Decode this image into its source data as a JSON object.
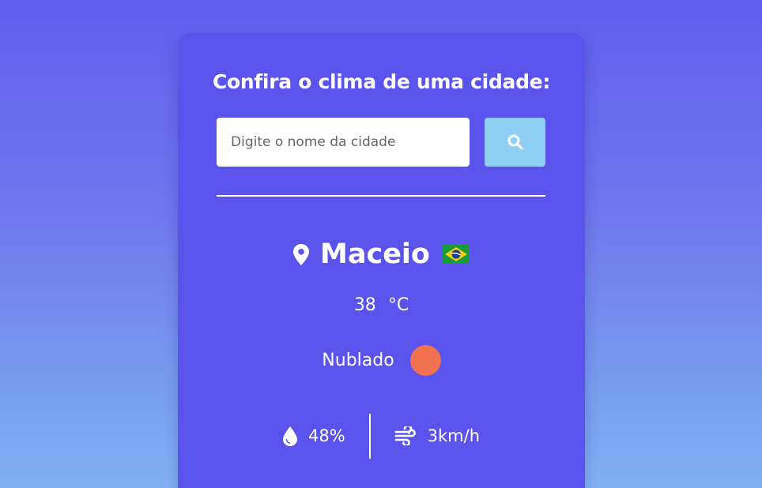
{
  "form": {
    "title": "Confira o clima de uma cidade:",
    "search_placeholder": "Digite o nome da cidade",
    "search_value": ""
  },
  "weather": {
    "city": "Maceio",
    "country_flag": "brazil-flag-icon",
    "temperature": "38",
    "temperature_unit": "°C",
    "description": "Nublado",
    "weather_icon": "weather-icon",
    "humidity": "48%",
    "wind": "3km/h"
  },
  "icons": {
    "search": "search-icon",
    "location": "location-pin-icon",
    "humidity": "water-drop-icon",
    "wind": "wind-icon"
  },
  "colors": {
    "background_top": "#5f5ef0",
    "background_bottom": "#80b2f2",
    "card": "#5b54ec",
    "search_button": "#8fcff5",
    "weather_icon": "#ef714f",
    "text": "#ffffff"
  }
}
